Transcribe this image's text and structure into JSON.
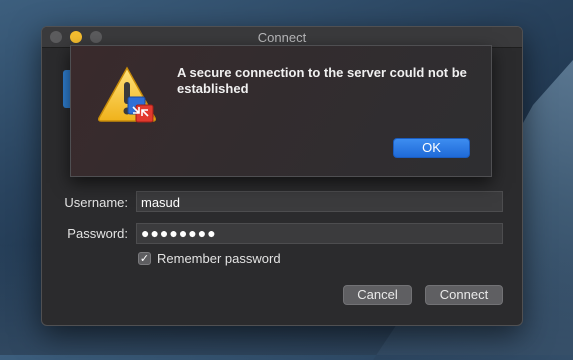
{
  "window": {
    "title": "Connect"
  },
  "form": {
    "username_label": "Username:",
    "username_value": "masud",
    "password_label": "Password:",
    "password_value": "●●●●●●●●",
    "remember_label": "Remember password",
    "remember_checked": true,
    "cancel_label": "Cancel",
    "connect_label": "Connect"
  },
  "alert": {
    "message": "A secure connection to the server could not be established",
    "ok_label": "OK",
    "icon": "warning-icon"
  },
  "colors": {
    "accent": "#1f6ad8",
    "minimize": "#f5bd2f"
  }
}
